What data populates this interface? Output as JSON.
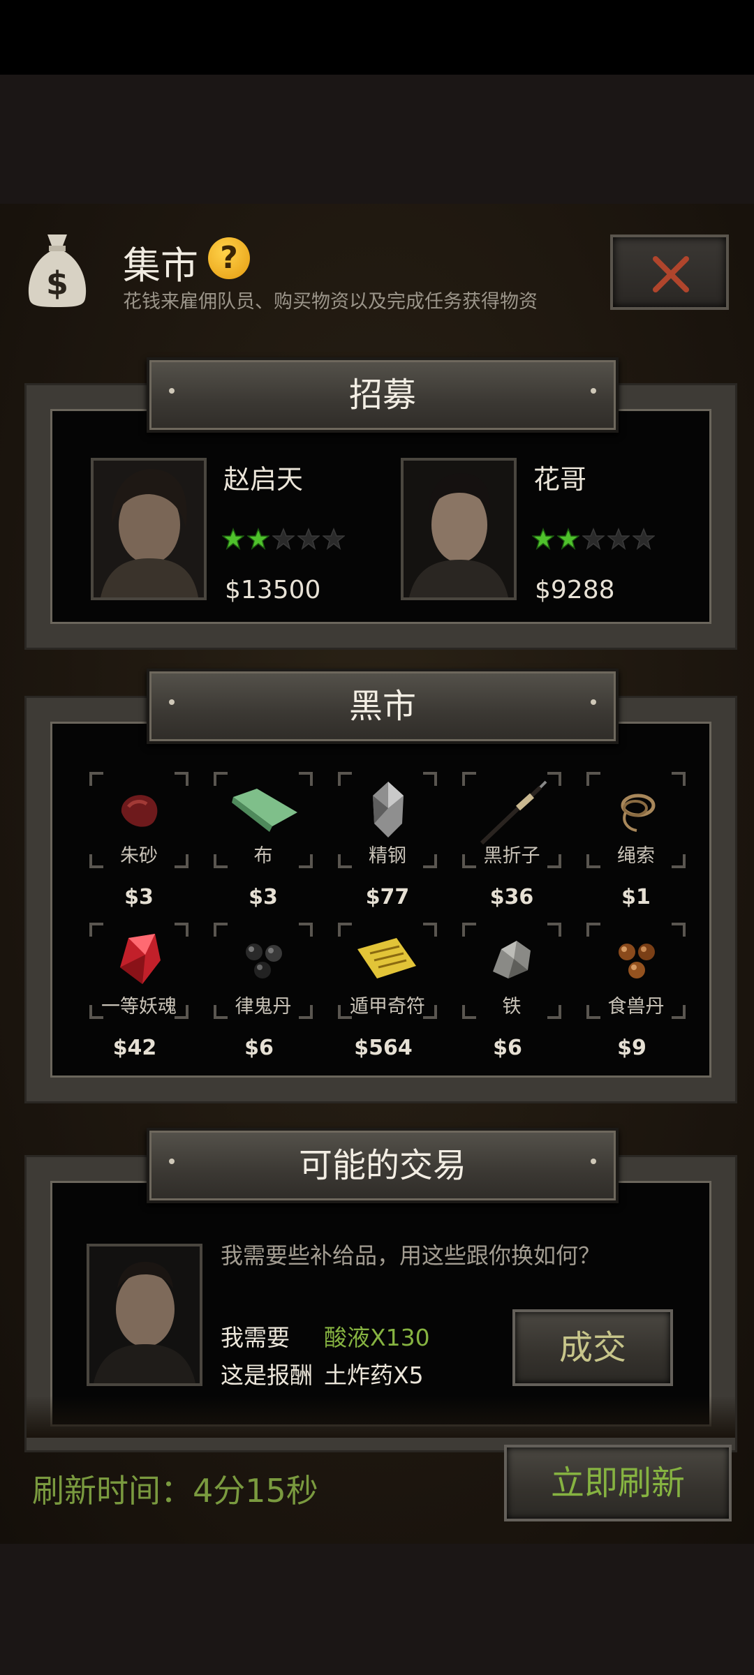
{
  "header": {
    "title": "集市",
    "help_glyph": "?",
    "subtitle": "花钱来雇佣队员、购买物资以及完成任务获得物资",
    "icons": {
      "bag": "money-bag-icon",
      "help": "help-icon",
      "close": "close-icon"
    },
    "close_color": "#b0452c"
  },
  "recruit": {
    "title": "招募",
    "candidates": [
      {
        "name": "赵启天",
        "stars_filled": 2,
        "stars_total": 5,
        "price": "$13500"
      },
      {
        "name": "花哥",
        "stars_filled": 2,
        "stars_total": 5,
        "price": "$9288"
      }
    ],
    "star_color": "#4fc22c"
  },
  "market": {
    "title": "黑市",
    "items": [
      {
        "name": "朱砂",
        "price": "$3",
        "icon": "cinnabar-icon"
      },
      {
        "name": "布",
        "price": "$3",
        "icon": "cloth-icon"
      },
      {
        "name": "精钢",
        "price": "$77",
        "icon": "steel-icon"
      },
      {
        "name": "黑折子",
        "price": "$36",
        "icon": "black-pole-icon"
      },
      {
        "name": "绳索",
        "price": "$1",
        "icon": "rope-icon"
      },
      {
        "name": "一等妖魂",
        "price": "$42",
        "icon": "red-crystal-icon"
      },
      {
        "name": "律鬼丹",
        "price": "$6",
        "icon": "black-pills-icon"
      },
      {
        "name": "遁甲奇符",
        "price": "$564",
        "icon": "talisman-icon"
      },
      {
        "name": "铁",
        "price": "$6",
        "icon": "iron-ore-icon"
      },
      {
        "name": "食兽丹",
        "price": "$9",
        "icon": "brown-pills-icon"
      }
    ]
  },
  "trade": {
    "title": "可能的交易",
    "message": "我需要些补给品，用这些跟你换如何？",
    "need_label": "我需要",
    "need_value": "酸液X130",
    "reward_label": "这是报酬",
    "reward_value": "土炸药X5",
    "deal_button": "成交",
    "need_color": "#86b341"
  },
  "footer": {
    "refresh_time": "刷新时间：4分15秒",
    "refresh_button": "立即刷新"
  }
}
